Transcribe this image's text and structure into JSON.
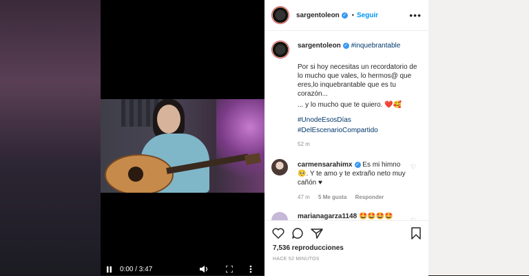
{
  "video": {
    "time_display": "0:00 / 3:47"
  },
  "post": {
    "username": "sargentoleon",
    "follow_label": "Seguir",
    "more_label": "•••",
    "dot": "•",
    "caption_hashtag": "#inquebrantable",
    "caption_body": "Por si hoy necesitas un recordatorio de lo mucho que vales, lo hermos@ que eres,lo inquebrantable que es tu corazón...",
    "caption_body2": "... y lo mucho que te quiero.",
    "caption_emoji": "❤️🥰",
    "tags": [
      "#UnodeEsosDías",
      "#DelEscenarioCompartido"
    ],
    "time": "52 m"
  },
  "comments": [
    {
      "username": "carmensarahimx",
      "text": "Es mi himno 🥺. Y te amo y te extraño neto muy cañón ♥",
      "time": "47 m",
      "likes": "5 Me gusta",
      "reply": "Responder"
    },
    {
      "username": "marianagarza1148",
      "text": "🤩🤩🤩🤩"
    }
  ],
  "footer": {
    "views": "7,536 reproducciones",
    "ago": "HACE 52 MINUTOS"
  }
}
